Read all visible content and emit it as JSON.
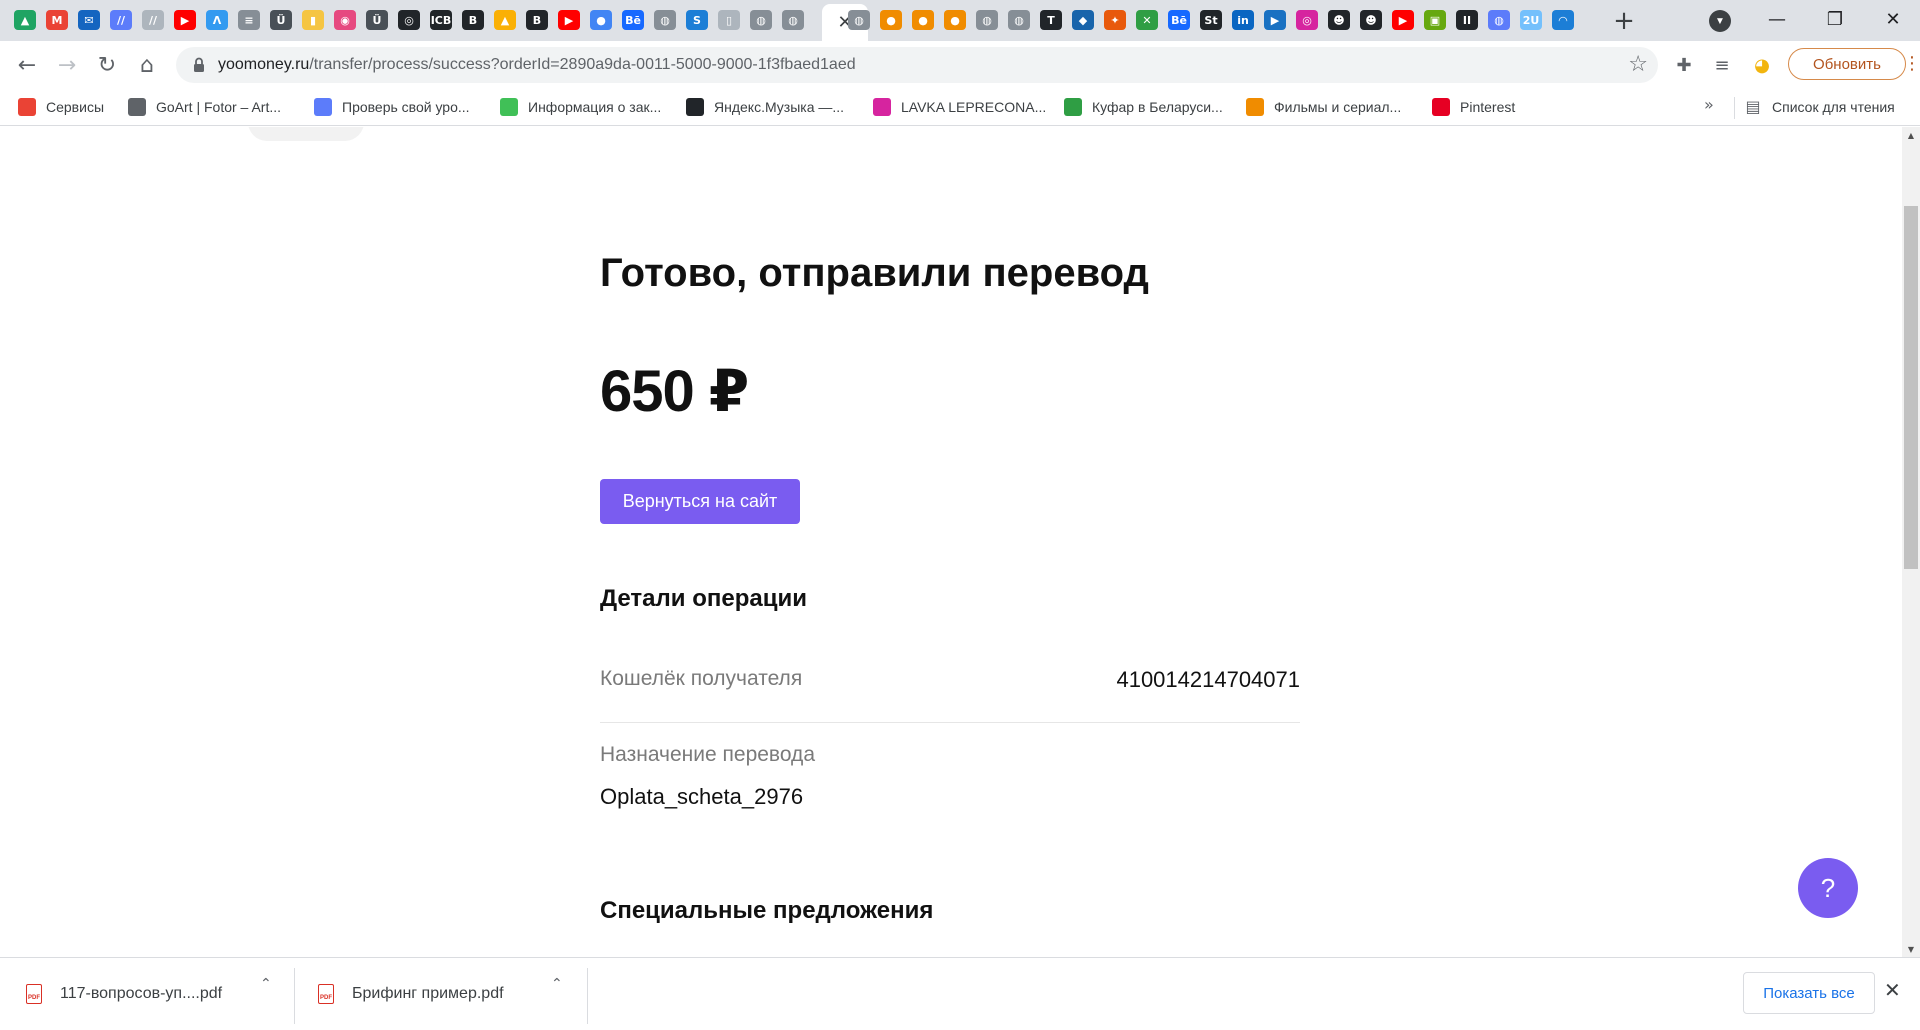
{
  "browser": {
    "tab_strip": {
      "active_tab_close": "✕",
      "new_tab": "+",
      "tab_icons": [
        {
          "name": "google-drive-tab-icon",
          "glyph": "▲",
          "color": "#1fa463"
        },
        {
          "name": "gmail-tab-icon",
          "glyph": "M",
          "color": "#ea4335"
        },
        {
          "name": "outlook-tab-icon",
          "glyph": "✉",
          "color": "#1565c0"
        },
        {
          "name": "script-tab-icon",
          "glyph": "//",
          "color": "#5c7cfa"
        },
        {
          "name": "script-tab-icon-2",
          "glyph": "//",
          "color": "#adb5bd"
        },
        {
          "name": "youtube-tab-icon",
          "glyph": "▶",
          "color": "#ff0000"
        },
        {
          "name": "app-tab-icon",
          "glyph": "Λ",
          "color": "#339af0"
        },
        {
          "name": "doc-tab-icon",
          "glyph": "≡",
          "color": "#868e96"
        },
        {
          "name": "owl-tab-icon",
          "glyph": "Ü",
          "color": "#495057"
        },
        {
          "name": "yellow-doc-tab-icon",
          "glyph": "▮",
          "color": "#f5c542"
        },
        {
          "name": "color-wheel-tab-icon",
          "glyph": "◉",
          "color": "#e64980"
        },
        {
          "name": "owl-tab-icon-2",
          "glyph": "Ü",
          "color": "#495057"
        },
        {
          "name": "target-tab-icon",
          "glyph": "◎",
          "color": "#212529"
        },
        {
          "name": "icb-tab-icon",
          "glyph": "ICB",
          "color": "#212529"
        },
        {
          "name": "b-tab-icon",
          "glyph": "B",
          "color": "#212529"
        },
        {
          "name": "drive-tab-icon-2",
          "glyph": "▲",
          "color": "#fab005"
        },
        {
          "name": "b-tab-icon-2",
          "glyph": "B",
          "color": "#212529"
        },
        {
          "name": "youtube-tab-icon-2",
          "glyph": "▶",
          "color": "#ff0000"
        },
        {
          "name": "chrome-tab-icon",
          "glyph": "●",
          "color": "#4285f4"
        },
        {
          "name": "behance-tab-icon",
          "glyph": "Bē",
          "color": "#1769ff"
        },
        {
          "name": "globe-tab-icon",
          "glyph": "◍",
          "color": "#868e96"
        },
        {
          "name": "s-tab-icon",
          "glyph": "S",
          "color": "#1c7ed6"
        },
        {
          "name": "file-tab-icon",
          "glyph": "▯",
          "color": "#adb5bd"
        },
        {
          "name": "globe-tab-icon-2",
          "glyph": "◍",
          "color": "#868e96"
        },
        {
          "name": "globe-tab-icon-3",
          "glyph": "◍",
          "color": "#868e96"
        }
      ],
      "tab_icons_right": [
        {
          "name": "globe-tab-icon-4",
          "glyph": "◍",
          "color": "#868e96"
        },
        {
          "name": "orange-tab-icon",
          "glyph": "●",
          "color": "#f08c00"
        },
        {
          "name": "orange-tab-icon-2",
          "glyph": "●",
          "color": "#f08c00"
        },
        {
          "name": "orange-tab-icon-3",
          "glyph": "●",
          "color": "#f08c00"
        },
        {
          "name": "globe-tab-icon-5",
          "glyph": "◍",
          "color": "#868e96"
        },
        {
          "name": "globe-tab-icon-6",
          "glyph": "◍",
          "color": "#868e96"
        },
        {
          "name": "t-tab-icon",
          "glyph": "T",
          "color": "#212529"
        },
        {
          "name": "domino-tab-icon",
          "glyph": "◆",
          "color": "#1864ab"
        },
        {
          "name": "fox-tab-icon",
          "glyph": "✦",
          "color": "#e8590c"
        },
        {
          "name": "kufar-tab-icon",
          "glyph": "✕",
          "color": "#2f9e44"
        },
        {
          "name": "behance-tab-icon-2",
          "glyph": "Bē",
          "color": "#1769ff"
        },
        {
          "name": "st-tab-icon",
          "glyph": "St",
          "color": "#212529"
        },
        {
          "name": "linkedin-tab-icon",
          "glyph": "in",
          "color": "#0a66c2"
        },
        {
          "name": "video-tab-icon",
          "glyph": "▶",
          "color": "#1971c2"
        },
        {
          "name": "instagram-tab-icon",
          "glyph": "◎",
          "color": "#d6249f"
        },
        {
          "name": "face-tab-icon",
          "glyph": "☻",
          "color": "#212529"
        },
        {
          "name": "face-tab-icon-2",
          "glyph": "☻",
          "color": "#212529"
        },
        {
          "name": "youtube-tab-icon-3",
          "glyph": "▶",
          "color": "#ff0000"
        },
        {
          "name": "green-doc-tab-icon",
          "glyph": "▣",
          "color": "#66a80f"
        },
        {
          "name": "pause-tab-icon",
          "glyph": "II",
          "color": "#212529"
        },
        {
          "name": "globe-tab-icon-7",
          "glyph": "◍",
          "color": "#5c7cfa"
        },
        {
          "name": "2u-tab-icon",
          "glyph": "2U",
          "color": "#74c0fc"
        },
        {
          "name": "wave-tab-icon",
          "glyph": "◠",
          "color": "#1c7ed6"
        }
      ]
    },
    "url": {
      "host": "yoomoney.ru",
      "path": "/transfer/process/success?orderId=2890a9da-0011-5000-9000-1f3fbaed1aed"
    },
    "update_button": "Обновить",
    "bookmarks": [
      {
        "label": "Сервисы",
        "icon": "apps-grid-icon",
        "color": "#ea4335"
      },
      {
        "label": "GoArt | Fotor – Art...",
        "icon": "globe-icon",
        "color": "#5f6368"
      },
      {
        "label": "Проверь свой уро...",
        "icon": "emblem-icon",
        "color": "#5c7cfa"
      },
      {
        "label": "Информация о зак...",
        "icon": "leaf-icon",
        "color": "#40c057"
      },
      {
        "label": "Яндекс.Музыка —...",
        "icon": "pause-icon",
        "color": "#212529"
      },
      {
        "label": "LAVKA LEPRECONA...",
        "icon": "instagram-icon",
        "color": "#d6249f"
      },
      {
        "label": "Куфар в Беларуси...",
        "icon": "kufar-icon",
        "color": "#2f9e44"
      },
      {
        "label": "Фильмы и сериал...",
        "icon": "hd-icon",
        "color": "#f08c00"
      },
      {
        "label": "Pinterest",
        "icon": "pinterest-icon",
        "color": "#e60023"
      }
    ],
    "reading_list": "Список для чтения"
  },
  "page": {
    "title": "Готово, отправили перевод",
    "amount": "650 ₽",
    "return_button": "Вернуться на сайт",
    "details_title": "Детали операции",
    "recipient_label": "Кошелёк получателя",
    "recipient_value": "410014214704071",
    "purpose_label": "Назначение перевода",
    "purpose_value": "Oplata_scheta_2976",
    "offers_title": "Специальные предложения",
    "help_button": "?"
  },
  "downloads": {
    "items": [
      {
        "name": "117-вопросов-уп....pdf",
        "type": "PDF"
      },
      {
        "name": "Брифинг пример.pdf",
        "type": "PDF"
      }
    ],
    "show_all": "Показать все"
  },
  "colors": {
    "accent": "#7a5cf0",
    "tabstrip_bg": "#dee1e6",
    "omnibox_bg": "#f1f3f4",
    "update_outline": "#d68a4a",
    "link_blue": "#1a73e8"
  }
}
